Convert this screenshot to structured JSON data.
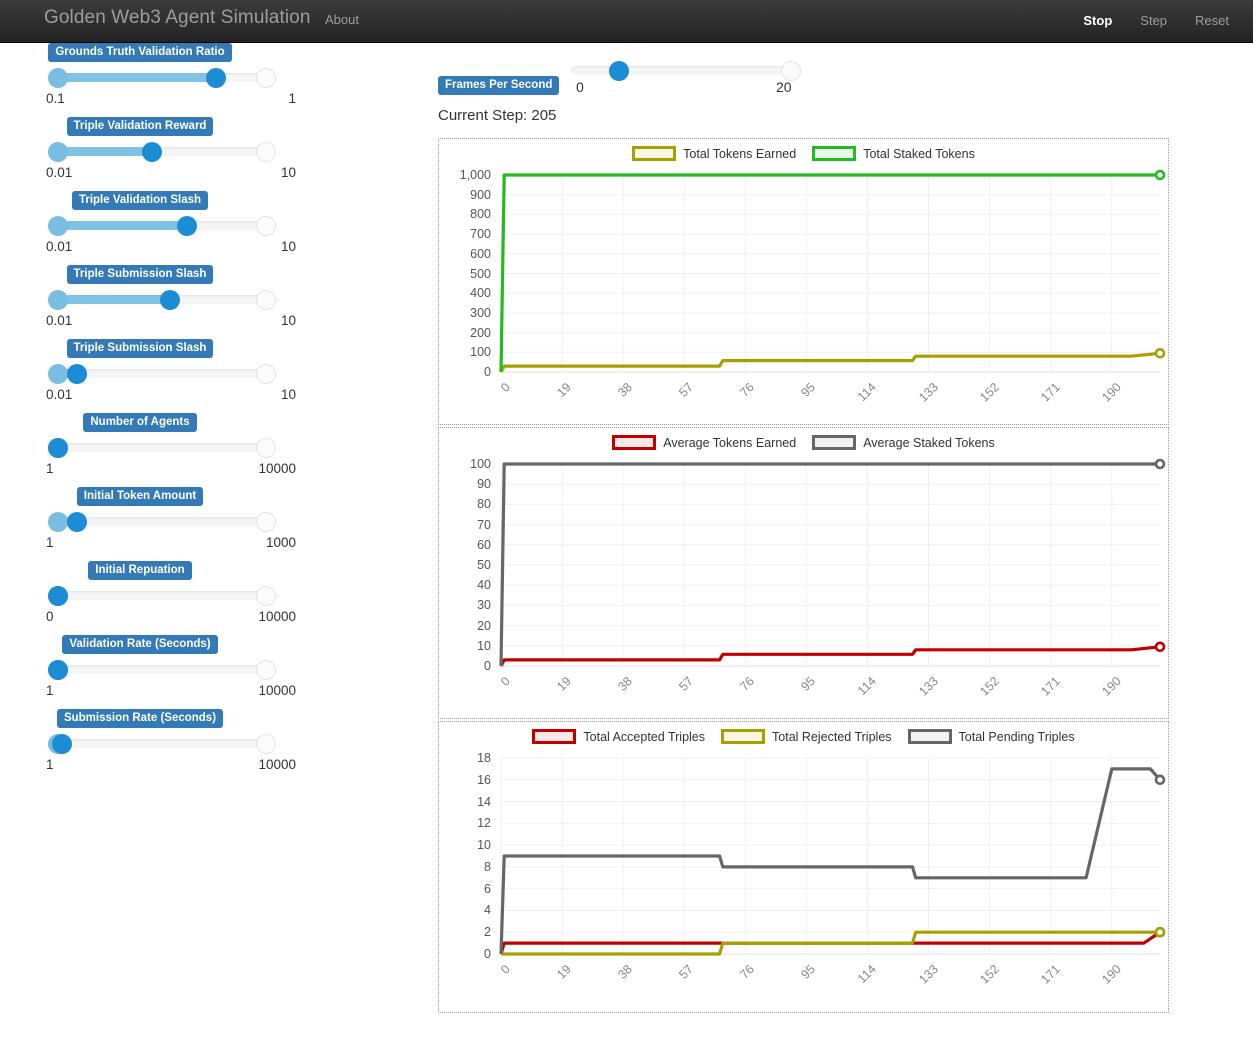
{
  "navbar": {
    "brand": "Golden Web3 Agent Simulation",
    "about": "About",
    "actions": [
      {
        "label": "Stop",
        "state": "active"
      },
      {
        "label": "Step",
        "state": "dim"
      },
      {
        "label": "Reset",
        "state": "dim"
      }
    ]
  },
  "sidebar": {
    "sliders": [
      {
        "label": "Grounds Truth Validation Ratio",
        "min": "0.1",
        "max": "1",
        "left_pct": 0,
        "right_pct": 76
      },
      {
        "label": "Triple Validation Reward",
        "min": "0.01",
        "max": "10",
        "left_pct": 0,
        "right_pct": 45
      },
      {
        "label": "Triple Validation Slash",
        "min": "0.01",
        "max": "10",
        "left_pct": 0,
        "right_pct": 62
      },
      {
        "label": "Triple Submission Slash",
        "min": "0.01",
        "max": "10",
        "left_pct": 0,
        "right_pct": 54
      },
      {
        "label": "Triple Submission Slash",
        "min": "0.01",
        "max": "10",
        "left_pct": 0,
        "right_pct": 9
      },
      {
        "label": "Number of Agents",
        "min": "1",
        "max": "10000",
        "left_pct": 0,
        "right_pct": 0
      },
      {
        "label": "Initial Token Amount",
        "min": "1",
        "max": "1000",
        "left_pct": 0,
        "right_pct": 9
      },
      {
        "label": "Initial Repuation",
        "min": "0",
        "max": "10000",
        "left_pct": 0,
        "right_pct": 0
      },
      {
        "label": "Validation Rate (Seconds)",
        "min": "1",
        "max": "10000",
        "left_pct": 0,
        "right_pct": 0
      },
      {
        "label": "Submission Rate (Seconds)",
        "min": "1",
        "max": "10000",
        "left_pct": 0,
        "right_pct": 2
      }
    ]
  },
  "fps": {
    "label": "Frames Per Second",
    "min": "0",
    "max": "20",
    "value_pct": 18
  },
  "current_step": "Current Step: 205",
  "colors": {
    "brand_blue": "#337ab7",
    "olive": "#a8a000",
    "green": "#22bb22",
    "red": "#c00000",
    "gray": "#666666",
    "navbar_bg": "#222222"
  },
  "chart_data": [
    {
      "type": "line",
      "title": "",
      "xlabel": "",
      "ylabel": "",
      "grid": true,
      "legend_position": "top",
      "xlim": [
        0,
        205
      ],
      "ylim": [
        0,
        1000
      ],
      "xticks": [
        "0",
        "19",
        "38",
        "57",
        "76",
        "95",
        "114",
        "133",
        "152",
        "171",
        "190"
      ],
      "yticks": [
        "0",
        "100",
        "200",
        "300",
        "400",
        "500",
        "600",
        "700",
        "800",
        "900",
        "1,000"
      ],
      "series": [
        {
          "name": "Total Tokens Earned",
          "color": "#a8a000",
          "x": [
            0,
            1,
            68,
            69,
            128,
            129,
            196,
            205
          ],
          "values": [
            0,
            30,
            30,
            58,
            58,
            80,
            80,
            95
          ]
        },
        {
          "name": "Total Staked Tokens",
          "color": "#22bb22",
          "x": [
            0,
            1,
            205
          ],
          "values": [
            0,
            1000,
            1000
          ]
        }
      ]
    },
    {
      "type": "line",
      "title": "",
      "xlabel": "",
      "ylabel": "",
      "grid": true,
      "legend_position": "top",
      "xlim": [
        0,
        205
      ],
      "ylim": [
        0,
        100
      ],
      "xticks": [
        "0",
        "19",
        "38",
        "57",
        "76",
        "95",
        "114",
        "133",
        "152",
        "171",
        "190"
      ],
      "yticks": [
        "0",
        "10",
        "20",
        "30",
        "40",
        "50",
        "60",
        "70",
        "80",
        "90",
        "100"
      ],
      "series": [
        {
          "name": "Average Tokens Earned",
          "color": "#c00000",
          "x": [
            0,
            1,
            68,
            69,
            128,
            129,
            196,
            205
          ],
          "values": [
            0,
            3,
            3,
            5.8,
            5.8,
            8,
            8,
            9.5
          ]
        },
        {
          "name": "Average Staked Tokens",
          "color": "#666666",
          "x": [
            0,
            1,
            205
          ],
          "values": [
            0,
            100,
            100
          ]
        }
      ]
    },
    {
      "type": "line",
      "title": "",
      "xlabel": "",
      "ylabel": "",
      "grid": true,
      "legend_position": "top",
      "xlim": [
        0,
        205
      ],
      "ylim": [
        0,
        18
      ],
      "xticks": [
        "0",
        "19",
        "38",
        "57",
        "76",
        "95",
        "114",
        "133",
        "152",
        "171",
        "190"
      ],
      "yticks": [
        "0",
        "2",
        "4",
        "6",
        "8",
        "10",
        "12",
        "14",
        "16",
        "18"
      ],
      "series": [
        {
          "name": "Total Accepted Triples",
          "color": "#c00000",
          "x": [
            0,
            1,
            200,
            205
          ],
          "values": [
            0,
            1,
            1,
            2
          ]
        },
        {
          "name": "Total Rejected Triples",
          "color": "#a8a000",
          "x": [
            0,
            68,
            69,
            128,
            129,
            205
          ],
          "values": [
            0,
            0,
            1,
            1,
            2,
            2
          ]
        },
        {
          "name": "Total Pending Triples",
          "color": "#666666",
          "x": [
            0,
            1,
            68,
            69,
            128,
            129,
            182,
            190,
            202,
            205
          ],
          "values": [
            0,
            9,
            9,
            8,
            8,
            7,
            7,
            17,
            17,
            16
          ]
        }
      ]
    }
  ]
}
